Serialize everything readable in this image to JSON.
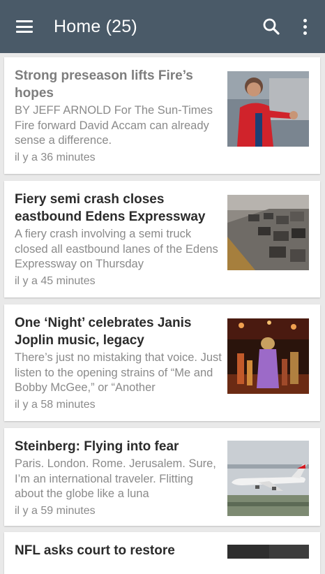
{
  "appbar": {
    "title": "Home (25)",
    "menu_icon": "hamburger-menu-icon",
    "search_icon": "search-icon",
    "more_icon": "more-vertical-icon",
    "color": "#4a5a68"
  },
  "articles": [
    {
      "headline": "Strong preseason lifts Fire’s hopes",
      "snippet": "BY JEFF ARNOLD For The Sun-Times Fire forward David Accam can already sense a difference.",
      "time": "il y a 36 minutes",
      "read": true
    },
    {
      "headline": "Fiery semi crash closes eastbound Edens Expressway",
      "snippet": "A fiery crash involving a semi truck closed all eastbound lanes of the Edens Expressway on Thursday",
      "time": "il y a 45 minutes",
      "read": false
    },
    {
      "headline": "One ‘Night’ celebrates Janis Joplin music, legacy",
      "snippet": "There’s just no mistaking that voice. Just listen to the opening strains of “Me and Bobby McGee,” or “Another",
      "time": "il y a 58 minutes",
      "read": false
    },
    {
      "headline": "Steinberg: Flying into fear",
      "snippet": "Paris. London. Rome. Jerusalem. Sure, I’m an international traveler. Flitting about the globe like a luna",
      "time": "il y a 59 minutes",
      "read": false
    },
    {
      "headline": "NFL asks court to restore",
      "snippet": "",
      "time": "",
      "read": false
    }
  ]
}
